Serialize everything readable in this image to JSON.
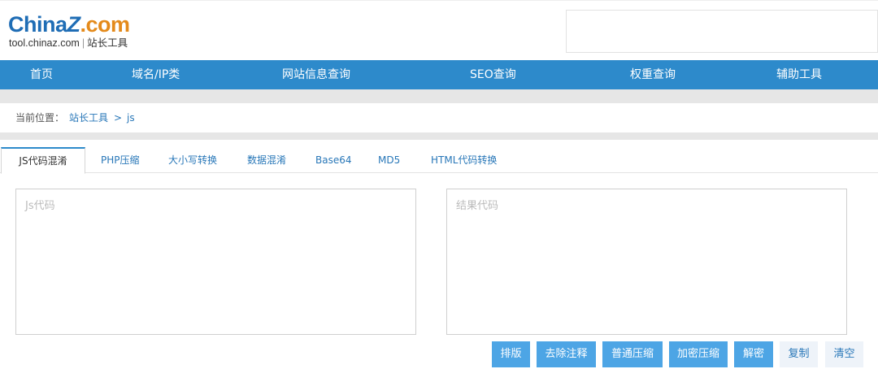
{
  "header": {
    "logo": {
      "china": "China",
      "z": "Z",
      "com": ".com",
      "domain": "tool.chinaz.com",
      "separator": "|",
      "site_name": "站长工具"
    }
  },
  "nav": {
    "items": [
      "首页",
      "域名/IP类",
      "网站信息查询",
      "SEO查询",
      "权重查询",
      "辅助工具"
    ]
  },
  "breadcrumb": {
    "label": "当前位置：",
    "link1": "站长工具",
    "separator": ">",
    "link2": "js"
  },
  "tabs": [
    "JS代码混淆",
    "PHP压缩",
    "大小写转换",
    "数据混淆",
    "Base64",
    "MD5",
    "HTML代码转换"
  ],
  "editor": {
    "input_placeholder": "Js代码",
    "input_value": "",
    "output_placeholder": "结果代码",
    "output_value": ""
  },
  "buttons": [
    "排版",
    "去除注释",
    "普通压缩",
    "加密压缩",
    "解密",
    "复制",
    "清空"
  ],
  "colors": {
    "nav_bg": "#2d8acb",
    "link": "#2877b8",
    "primary_button": "#4da5e5",
    "light_button": "#eef3f9"
  }
}
